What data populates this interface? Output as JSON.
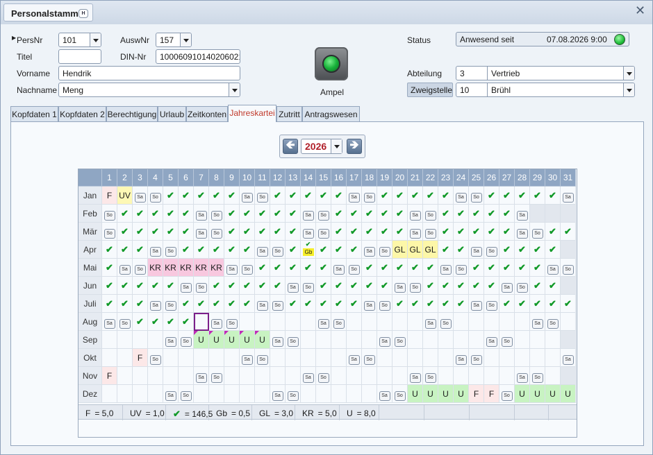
{
  "window": {
    "title": "Personalstamm",
    "help_label": "H",
    "close": "✕"
  },
  "form": {
    "persnr_label": "PersNr",
    "persnr_value": "101",
    "auswnr_label": "AuswNr",
    "auswnr_value": "157",
    "titel_label": "Titel",
    "titel_value": "",
    "din_label": "DIN-Nr",
    "din_value": "1000609101402060210",
    "vorname_label": "Vorname",
    "vorname_value": "Hendrik",
    "nachname_label": "Nachname",
    "nachname_value": "Meng",
    "ampel_label": "Ampel",
    "status_label": "Status",
    "status_text": "Anwesend seit",
    "status_date": "07.08.2026  9:00",
    "abteilung_label": "Abteilung",
    "abteilung_nr": "3",
    "abteilung_name": "Vertrieb",
    "zweigstelle_label": "Zweigstelle",
    "zweigstelle_nr": "10",
    "zweigstelle_name": "Brühl"
  },
  "tabs": [
    "Kopfdaten 1",
    "Kopfdaten 2",
    "Berechtigung",
    "Urlaub",
    "Zeitkonten",
    "Jahreskartei",
    "Zutritt",
    "Antragswesen"
  ],
  "active_tab": 5,
  "year": "2026",
  "calendar": {
    "months": [
      "Jan",
      "Feb",
      "Mär",
      "Apr",
      "Mai",
      "Jun",
      "Juli",
      "Aug",
      "Sep",
      "Okt",
      "Nov",
      "Dez"
    ],
    "we_labels": {
      "Sa": "Sa",
      "So": "So"
    },
    "check": "✔",
    "special": {
      "1-1": {
        "t": "F",
        "bg": "#fce8e8"
      },
      "1-2": {
        "t": "UV",
        "bg": "#fdf8b5"
      },
      "4-14": {
        "t": "Gb",
        "bg": "#f6ee2a"
      },
      "4-20": {
        "t": "GL",
        "bg": "#fdf7a8"
      },
      "4-21": {
        "t": "GL",
        "bg": "#fdf7a8"
      },
      "4-22": {
        "t": "GL",
        "bg": "#fdf7a8"
      },
      "5-4": {
        "t": "KR",
        "bg": "#f8c8df"
      },
      "5-5": {
        "t": "KR",
        "bg": "#f8c8df"
      },
      "5-6": {
        "t": "KR",
        "bg": "#f8c8df"
      },
      "5-7": {
        "t": "KR",
        "bg": "#f8c8df"
      },
      "5-8": {
        "t": "KR",
        "bg": "#f8c8df"
      },
      "9-7": {
        "t": "U",
        "bg": "#c8f3c2",
        "mark": true
      },
      "9-8": {
        "t": "U",
        "bg": "#c8f3c2",
        "mark": true
      },
      "9-9": {
        "t": "U",
        "bg": "#c8f3c2",
        "mark": true
      },
      "9-10": {
        "t": "U",
        "bg": "#c8f3c2",
        "mark": true
      },
      "9-11": {
        "t": "U",
        "bg": "#c8f3c2",
        "mark": true
      },
      "10-3": {
        "t": "F",
        "bg": "#fce8e8"
      },
      "11-1": {
        "t": "F",
        "bg": "#fce8e8"
      },
      "12-21": {
        "t": "U",
        "bg": "#c8f3c2"
      },
      "12-22": {
        "t": "U",
        "bg": "#c8f3c2"
      },
      "12-23": {
        "t": "U",
        "bg": "#c8f3c2"
      },
      "12-24": {
        "t": "U",
        "bg": "#c8f3c2"
      },
      "12-25": {
        "t": "F",
        "bg": "#fce8e8"
      },
      "12-26": {
        "t": "F",
        "bg": "#fce8e8"
      },
      "12-28": {
        "t": "U",
        "bg": "#c8f3c2"
      },
      "12-29": {
        "t": "U",
        "bg": "#c8f3c2"
      },
      "12-30": {
        "t": "U",
        "bg": "#c8f3c2"
      },
      "12-31": {
        "t": "U",
        "bg": "#c8f3c2"
      }
    },
    "today": "8-7",
    "present_until": "8-6"
  },
  "summary": [
    {
      "label": "F",
      "value": "= 5,0"
    },
    {
      "label": "UV",
      "value": "= 1,0"
    },
    {
      "label": "✔",
      "value": "= 146,5"
    },
    {
      "label": "Gb",
      "value": "= 0,5"
    },
    {
      "label": "GL",
      "value": "= 3,0"
    },
    {
      "label": "KR",
      "value": "= 5,0"
    },
    {
      "label": "U",
      "value": "= 8,0"
    },
    {
      "label": "",
      "value": ""
    },
    {
      "label": "",
      "value": ""
    },
    {
      "label": "",
      "value": ""
    },
    {
      "label": "",
      "value": ""
    }
  ],
  "colors": {
    "accent": "#8fa6c3",
    "check": "#119928",
    "active_tab_text": "#c0392b",
    "today_border": "#7b1f8a"
  }
}
